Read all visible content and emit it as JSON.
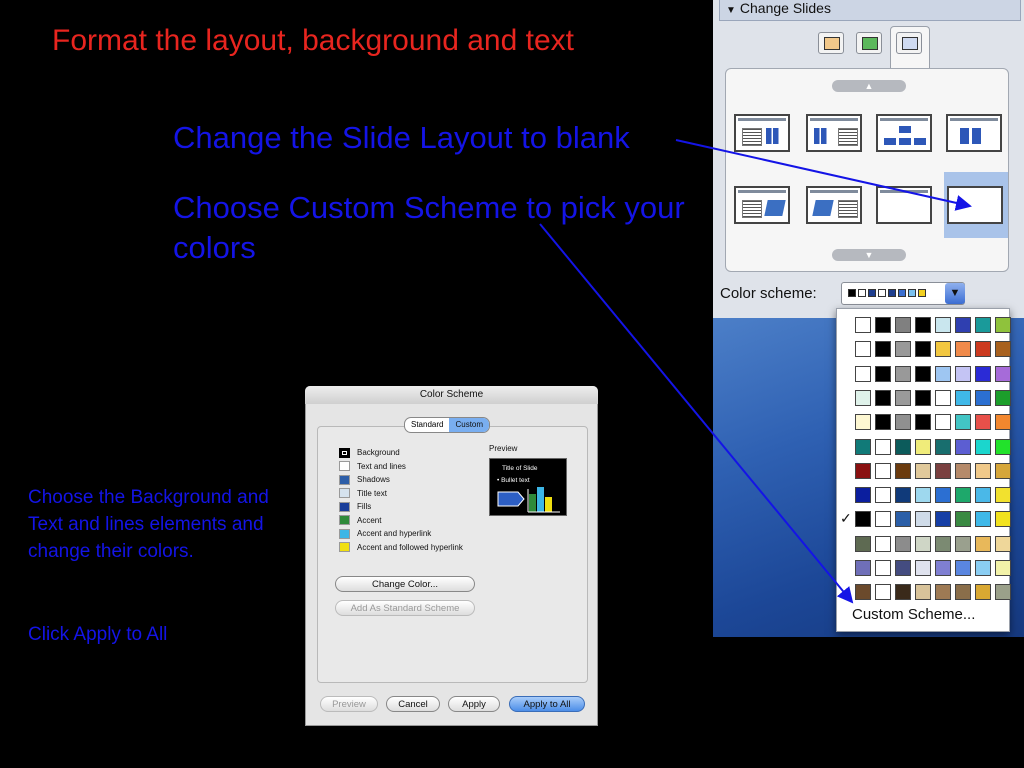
{
  "slide": {
    "title": "Format the layout, background and text",
    "instruction_layout": "Change the Slide Layout to blank",
    "instruction_scheme": "Choose Custom Scheme to pick your colors",
    "note_colors": "Choose the Background and Text and lines elements and change their colors.",
    "note_apply": "Click Apply to All"
  },
  "palette": {
    "header": "Change Slides",
    "color_scheme_label": "Color scheme:",
    "custom_scheme_item": "Custom Scheme...",
    "checkmark": "✓",
    "scheme_rows": [
      [
        "#ffffff",
        "#000000",
        "#808080",
        "#000000",
        "#c9e6ee",
        "#2f3fb0",
        "#1a9a9a",
        "#8fc23c"
      ],
      [
        "#ffffff",
        "#000000",
        "#999999",
        "#000000",
        "#f2c740",
        "#f08a4a",
        "#cc3a1f",
        "#a8611e"
      ],
      [
        "#ffffff",
        "#000000",
        "#999999",
        "#000000",
        "#9ec6f2",
        "#c4c4f4",
        "#2b2bd6",
        "#a66bd9"
      ],
      [
        "#dff2ea",
        "#000000",
        "#9a9a9a",
        "#000000",
        "#ffffff",
        "#3fb8e8",
        "#2b6fd1",
        "#1c9e2b"
      ],
      [
        "#fdf7d2",
        "#000000",
        "#909090",
        "#000000",
        "#ffffff",
        "#42c5c5",
        "#e8504a",
        "#f2872e"
      ],
      [
        "#117a78",
        "#ffffff",
        "#0c5b5b",
        "#f0ec7a",
        "#186e6e",
        "#5c5ed2",
        "#1bd6cd",
        "#22e22b"
      ],
      [
        "#8a1010",
        "#ffffff",
        "#6b3b0e",
        "#e0c99b",
        "#7a4040",
        "#b58a6a",
        "#f0c98a",
        "#d6a63a"
      ],
      [
        "#0b1e9e",
        "#ffffff",
        "#103a7a",
        "#9ed8ee",
        "#2c6fd2",
        "#1ea86b",
        "#4ab8e8",
        "#f2e12e"
      ],
      [
        "#000000",
        "#ffffff",
        "#2b5fa8",
        "#cfdbe8",
        "#163fa6",
        "#3a8a42",
        "#3fb8e8",
        "#f2e21e"
      ],
      [
        "#5e6a52",
        "#ffffff",
        "#8c8c8c",
        "#cfd6c6",
        "#7b8a72",
        "#9aa08e",
        "#e8b85a",
        "#efd79a"
      ],
      [
        "#6f6fb8",
        "#ffffff",
        "#444c80",
        "#dfe2ee",
        "#7f7fd2",
        "#5a86e0",
        "#8acdf2",
        "#f2f2a8"
      ],
      [
        "#6b4a2c",
        "#ffffff",
        "#3a2a1a",
        "#d8c39a",
        "#9e7a54",
        "#8a6e4a",
        "#d9a832",
        "#9aa08a"
      ]
    ],
    "dropdown_swatches": [
      "#000000",
      "#ffffff",
      "#1f3f8f",
      "#ffffff",
      "#1f3f8f",
      "#3b6fd0",
      "#7ac0ee",
      "#f2d020"
    ]
  },
  "dialog": {
    "title": "Color Scheme",
    "tabs": [
      "Standard",
      "Custom"
    ],
    "items": [
      {
        "label": "Background",
        "color": "#000000"
      },
      {
        "label": "Text and lines",
        "color": "#ffffff"
      },
      {
        "label": "Shadows",
        "color": "#2d5ea8"
      },
      {
        "label": "Title text",
        "color": "#d5e2ee"
      },
      {
        "label": "Fills",
        "color": "#1a3e9a"
      },
      {
        "label": "Accent",
        "color": "#2f8a3a"
      },
      {
        "label": "Accent and hyperlink",
        "color": "#3db6e6"
      },
      {
        "label": "Accent and followed hyperlink",
        "color": "#f0df10"
      }
    ],
    "preview_label": "Preview",
    "preview_title": "Title of Slide",
    "preview_bullet": "•  Bullet text",
    "change_color": "Change Color...",
    "add_standard": "Add As Standard Scheme",
    "buttons": {
      "preview": "Preview",
      "cancel": "Cancel",
      "apply": "Apply",
      "apply_all": "Apply to All"
    }
  }
}
